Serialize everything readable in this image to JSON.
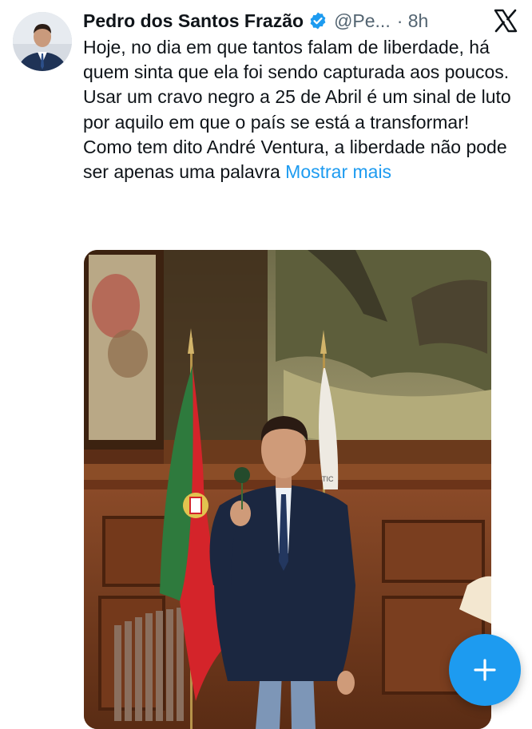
{
  "author": {
    "name": "Pedro dos Santos Frazão",
    "handle": "@Pe...",
    "time": "· 8h",
    "verified": true
  },
  "tweet": {
    "paragraphs": [
      "Hoje, no dia em que tantos falam de liberdade, há quem sinta que ela foi sendo capturada aos poucos.",
      "Usar um cravo negro a 25 de Abril é um sinal de luto por aquilo em que o país se está a transformar!",
      "Como tem dito André Ventura, a liberdade não pode ser apenas uma palavra"
    ],
    "show_more": "Mostrar mais"
  },
  "media": {
    "flag_text": "TIC"
  },
  "icons": {
    "verified": "verified-badge-icon",
    "logo": "x-logo-icon",
    "compose": "plus-icon"
  },
  "colors": {
    "accent": "#1d9bf0",
    "text": "#0f1419",
    "secondary": "#536471"
  }
}
